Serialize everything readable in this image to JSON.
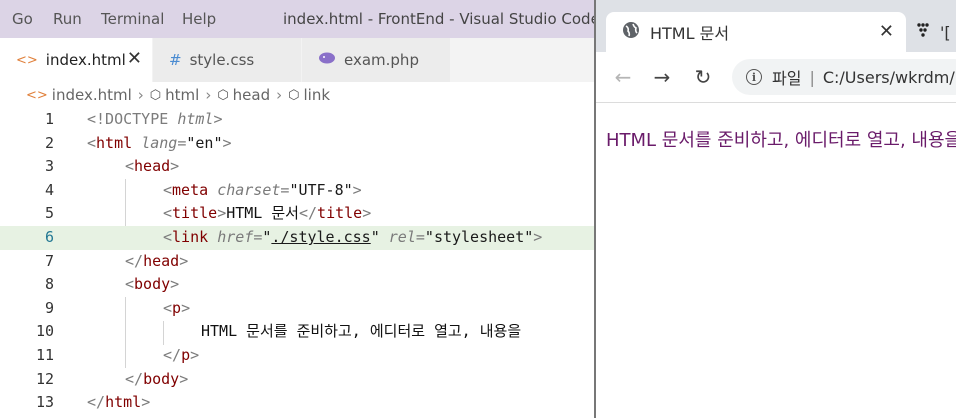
{
  "vscode": {
    "menu": [
      "Go",
      "Run",
      "Terminal",
      "Help"
    ],
    "window_title": "index.html - FrontEnd - Visual Studio Code",
    "tabs": [
      {
        "label": "index.html",
        "icon": "html-file-icon",
        "active": true
      },
      {
        "label": "style.css",
        "icon": "css-file-icon",
        "active": false
      },
      {
        "label": "exam.php",
        "icon": "php-file-icon",
        "active": false
      }
    ],
    "breadcrumb": [
      "index.html",
      "html",
      "head",
      "link"
    ],
    "line_numbers": [
      "1",
      "2",
      "3",
      "4",
      "5",
      "6",
      "7",
      "8",
      "9",
      "10",
      "11",
      "12",
      "13"
    ],
    "code": {
      "l1_doctype": "!DOCTYPE",
      "l1_html": "html",
      "tag_html": "html",
      "attr_lang": "lang",
      "val_en": "en",
      "tag_head": "head",
      "tag_meta": "meta",
      "attr_charset": "charset",
      "val_utf8": "UTF-8",
      "tag_title": "title",
      "title_text": "HTML 문서",
      "tag_link": "link",
      "attr_href": "href",
      "val_href": "./style.css",
      "attr_rel": "rel",
      "val_rel": "stylesheet",
      "tag_body": "body",
      "tag_p": "p",
      "p_text": "HTML 문서를 준비하고, 에디터로 열고, 내용을"
    },
    "highlighted_line": 6
  },
  "browser": {
    "tab_title": "HTML 문서",
    "other_tab_label": "'[",
    "address_scheme_label": "파일",
    "address_path": "C:/Users/wkrdm/",
    "page_text": "HTML 문서를 준비하고, 에디터로 열고, 내용을"
  },
  "colors": {
    "titlebar": "#dcd4e6",
    "tag": "#800000",
    "highlight_line": "#e7f2e3",
    "page_text": "#6a1b6a"
  }
}
